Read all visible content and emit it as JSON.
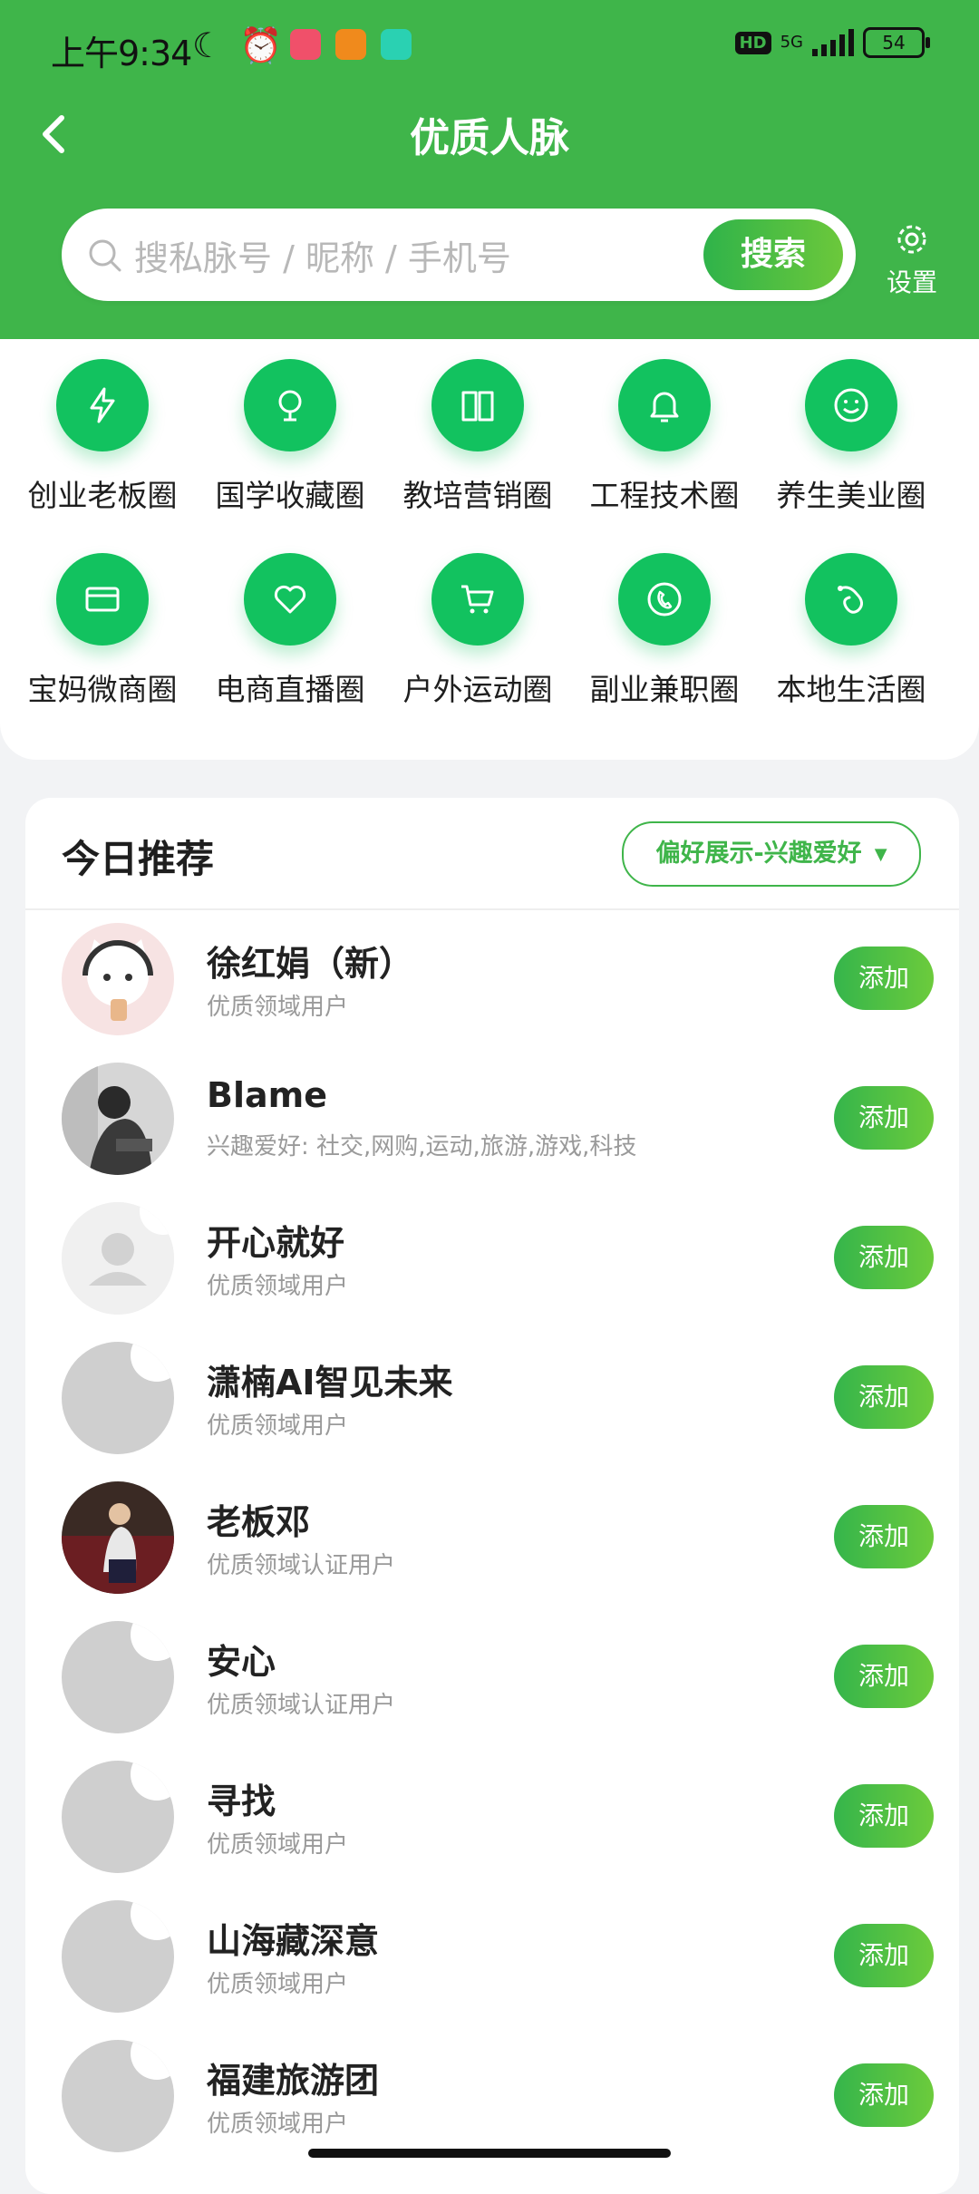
{
  "status_bar": {
    "time": "上午9:34",
    "network": "5G",
    "hd": "HD",
    "battery": "54"
  },
  "header": {
    "title": "优质人脉",
    "search_placeholder": "搜私脉号 / 昵称 / 手机号",
    "search_button": "搜索",
    "settings_label": "设置"
  },
  "categories": [
    {
      "label": "创业老板圈",
      "icon": "lightning-icon"
    },
    {
      "label": "国学收藏圈",
      "icon": "bulb-icon"
    },
    {
      "label": "教培营销圈",
      "icon": "book-icon"
    },
    {
      "label": "工程技术圈",
      "icon": "bell-icon"
    },
    {
      "label": "养生美业圈",
      "icon": "smile-icon"
    },
    {
      "label": "宝妈微商圈",
      "icon": "card-icon"
    },
    {
      "label": "电商直播圈",
      "icon": "heart-icon"
    },
    {
      "label": "户外运动圈",
      "icon": "cart-icon"
    },
    {
      "label": "副业兼职圈",
      "icon": "phone-icon"
    },
    {
      "label": "本地生活圈",
      "icon": "lasso-icon"
    }
  ],
  "recommend": {
    "title": "今日推荐",
    "pref_button": "偏好展示-兴趣爱好",
    "add_label": "添加",
    "users": [
      {
        "name": "徐红娟（新）",
        "desc": "优质领域用户"
      },
      {
        "name": "Blame",
        "desc": "兴趣爱好: 社交,网购,运动,旅游,游戏,科技"
      },
      {
        "name": "开心就好",
        "desc": "优质领域用户"
      },
      {
        "name": "潇楠AI智见未来",
        "desc": "优质领域用户"
      },
      {
        "name": "老板邓",
        "desc": "优质领域认证用户"
      },
      {
        "name": "安心",
        "desc": "优质领域认证用户"
      },
      {
        "name": "寻找",
        "desc": "优质领域用户"
      },
      {
        "name": "山海藏深意",
        "desc": "优质领域用户"
      },
      {
        "name": "福建旅游团",
        "desc": "优质领域用户"
      }
    ]
  },
  "colors": {
    "brand": "#3fb54a",
    "icon_bg": "#12c25f"
  }
}
